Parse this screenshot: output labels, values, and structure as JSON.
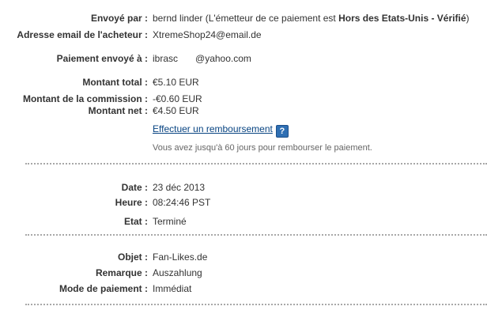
{
  "sender": {
    "label": "Envoyé par :",
    "name": "bernd linder",
    "detail_prefix": "(L'émetteur de ce paiement est ",
    "detail_bold": "Hors des Etats-Unis - Vérifié",
    "detail_suffix": ")"
  },
  "buyer_email": {
    "label": "Adresse email de l'acheteur :",
    "value": "XtremeShop24@email.de"
  },
  "sent_to": {
    "label": "Paiement envoyé à :",
    "value_start": "ibrasc",
    "value_end": "@yahoo.com"
  },
  "amounts": {
    "total_label": "Montant total :",
    "total_value": "€5.10 EUR",
    "fee_label": "Montant de la commission :",
    "fee_value": "-€0.60 EUR",
    "net_label": "Montant net :",
    "net_value": "€4.50 EUR"
  },
  "refund": {
    "link": "Effectuer un remboursement",
    "help": "?",
    "note": "Vous avez jusqu'à 60 jours pour rembourser le paiement."
  },
  "details": {
    "date_label": "Date :",
    "date_value": "23 déc 2013",
    "time_label": "Heure :",
    "time_value": "08:24:46 PST",
    "status_label": "Etat :",
    "status_value": "Terminé"
  },
  "payment": {
    "object_label": "Objet :",
    "object_value": "Fan-Likes.de",
    "remark_label": "Remarque :",
    "remark_value": "Auszahlung",
    "mode_label": "Mode de paiement :",
    "mode_value": "Immédiat"
  }
}
